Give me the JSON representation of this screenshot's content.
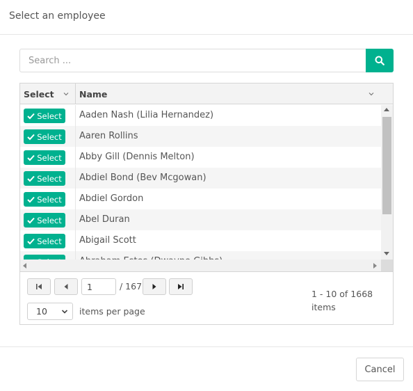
{
  "dialog": {
    "title": "Select an employee",
    "cancel_label": "Cancel"
  },
  "search": {
    "placeholder": "Search ...",
    "value": "",
    "button_icon": "search-icon"
  },
  "grid": {
    "columns": [
      {
        "label": "Select"
      },
      {
        "label": "Name"
      }
    ],
    "select_label": "Select",
    "rows": [
      {
        "name": "Aaden Nash (Lilia Hernandez)"
      },
      {
        "name": "Aaren Rollins"
      },
      {
        "name": "Abby Gill (Dennis Melton)"
      },
      {
        "name": "Abdiel Bond (Bev Mcgowan)"
      },
      {
        "name": "Abdiel Gordon"
      },
      {
        "name": "Abel Duran"
      },
      {
        "name": "Abigail Scott"
      },
      {
        "name": "Abraham Estes (Dwayne Gibbs)"
      }
    ]
  },
  "pager": {
    "current_page": "1",
    "total_pages": "/ 167",
    "page_size": "10",
    "items_per_page_label": "items per page",
    "info_line1": "1 - 10 of 1668",
    "info_line2": "items"
  },
  "colors": {
    "accent": "#00b18f"
  }
}
